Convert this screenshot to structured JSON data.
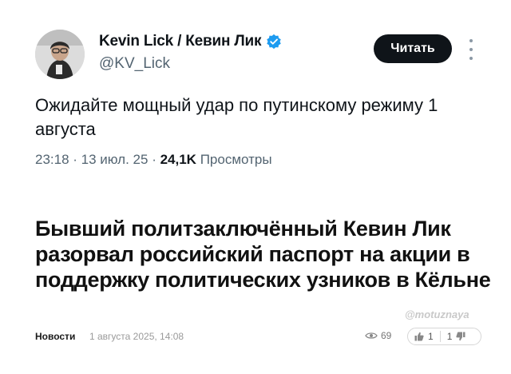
{
  "tweet": {
    "author_name": "Kevin Lick / Кевин Лик",
    "handle": "@KV_Lick",
    "follow_label": "Читать",
    "text": "Ожидайте мощный удар по путинскому режиму 1 августа",
    "time": "23:18",
    "date": "13 июл. 25",
    "views_count": "24,1K",
    "views_label": "Просмотры",
    "icons": {
      "verified": "verified-badge-icon",
      "more": "more-options-icon"
    },
    "colors": {
      "verified": "#1d9bf0",
      "button": "#0f1419"
    }
  },
  "article": {
    "headline": "Бывший политзаключённый Кевин Лик разорвал российский паспорт на акции в поддержку политических узников в Кёльне",
    "watermark": "@motuznaya",
    "category": "Новости",
    "date": "1 августа 2025, 14:08",
    "views": "69",
    "likes": "1",
    "dislikes": "1"
  }
}
